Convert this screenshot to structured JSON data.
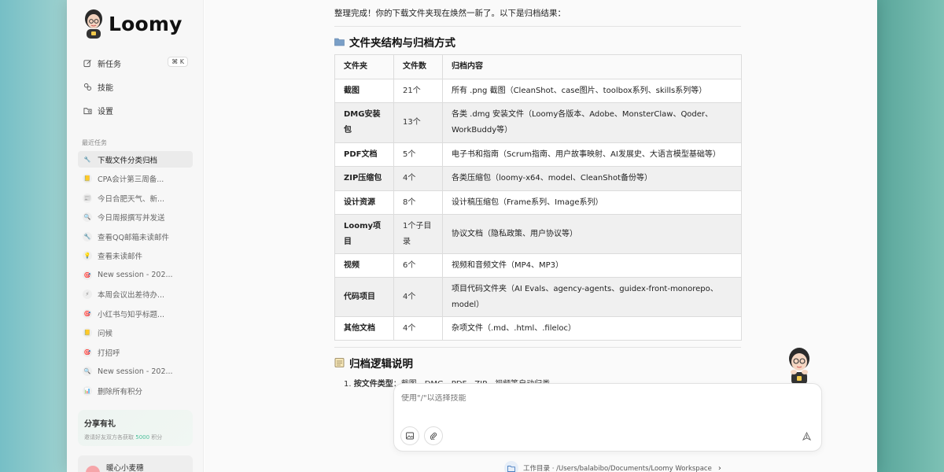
{
  "app": {
    "name": "Loomy"
  },
  "sidebar": {
    "nav": [
      {
        "label": "新任务",
        "icon": "edit-icon",
        "shortcut": "⌘ K"
      },
      {
        "label": "技能",
        "icon": "skills-icon"
      },
      {
        "label": "设置",
        "icon": "settings-folder-icon"
      }
    ],
    "recent_label": "最近任务",
    "tasks": [
      {
        "label": "下载文件分类归档",
        "icon": "wrench-icon",
        "active": true
      },
      {
        "label": "CPA会计第三周备...",
        "icon": "notebook-icon"
      },
      {
        "label": "今日合肥天气、新...",
        "icon": "news-icon"
      },
      {
        "label": "今日周报撰写并发送",
        "icon": "search-icon"
      },
      {
        "label": "查看QQ邮箱未读邮件",
        "icon": "wrench-icon"
      },
      {
        "label": "查看未读邮件",
        "icon": "lightbulb-icon"
      },
      {
        "label": "New session - 202...",
        "icon": "target-icon"
      },
      {
        "label": "本周会议出差待办...",
        "icon": "lightning-icon"
      },
      {
        "label": "小红书与知乎标题...",
        "icon": "target-icon"
      },
      {
        "label": "问候",
        "icon": "notebook-icon"
      },
      {
        "label": "打招呼",
        "icon": "target-icon"
      },
      {
        "label": "New session - 202...",
        "icon": "search-icon"
      },
      {
        "label": "删除所有积分",
        "icon": "bar-chart-icon"
      }
    ],
    "promo": {
      "title": "分享有礼",
      "sub_prefix": "邀请好友双方各获取",
      "sub_amount": "5000",
      "sub_suffix": "积分"
    },
    "user": {
      "name": "暖心小麦穗"
    }
  },
  "main": {
    "intro": "整理完成！你的下载文件夹现在焕然一新了。以下是归档结果：",
    "section1_title": "文件夹结构与归档方式",
    "table": {
      "headers": [
        "文件夹",
        "文件数",
        "归档内容"
      ],
      "rows": [
        [
          "截图",
          "21个",
          "所有 .png 截图（CleanShot、case图片、toolbox系列、skills系列等）"
        ],
        [
          "DMG安装包",
          "13个",
          "各类 .dmg 安装文件（Loomy各版本、Adobe、MonsterClaw、Qoder、WorkBuddy等）"
        ],
        [
          "PDF文档",
          "5个",
          "电子书和指南（Scrum指南、用户故事映射、AI发展史、大语言模型基础等）"
        ],
        [
          "ZIP压缩包",
          "4个",
          "各类压缩包（loomy-x64、model、CleanShot备份等）"
        ],
        [
          "设计资源",
          "8个",
          "设计稿压缩包（Frame系列、Image系列）"
        ],
        [
          "Loomy项目",
          "1个子目录",
          "协议文档（隐私政策、用户协议等）"
        ],
        [
          "视频",
          "6个",
          "视频和音频文件（MP4、MP3）"
        ],
        [
          "代码项目",
          "4个",
          "项目代码文件夹（AI Evals、agency-agents、guidex-front-monorepo、model）"
        ],
        [
          "其他文档",
          "4个",
          "杂项文件（.md、.html、.fileloc）"
        ]
      ]
    },
    "section2_title": "归档逻辑说明",
    "step1_num": "1.",
    "step1_bold": "按文件类型",
    "step1_rest": "：截图、DMG、PDF、ZIP、视频等自动归类"
  },
  "composer": {
    "placeholder": "使用\"/\"以选择技能",
    "image_button": "image-icon",
    "attach_button": "paperclip-icon",
    "send_button": "send-icon"
  },
  "workdir": {
    "label": "工作目录 · /Users/balabibo/Documents/Loomy Workspace"
  },
  "colors": {
    "accent": "#4bbf9a",
    "page_bg": "#fafafa",
    "sidebar_bg": "#f7f7f7"
  }
}
